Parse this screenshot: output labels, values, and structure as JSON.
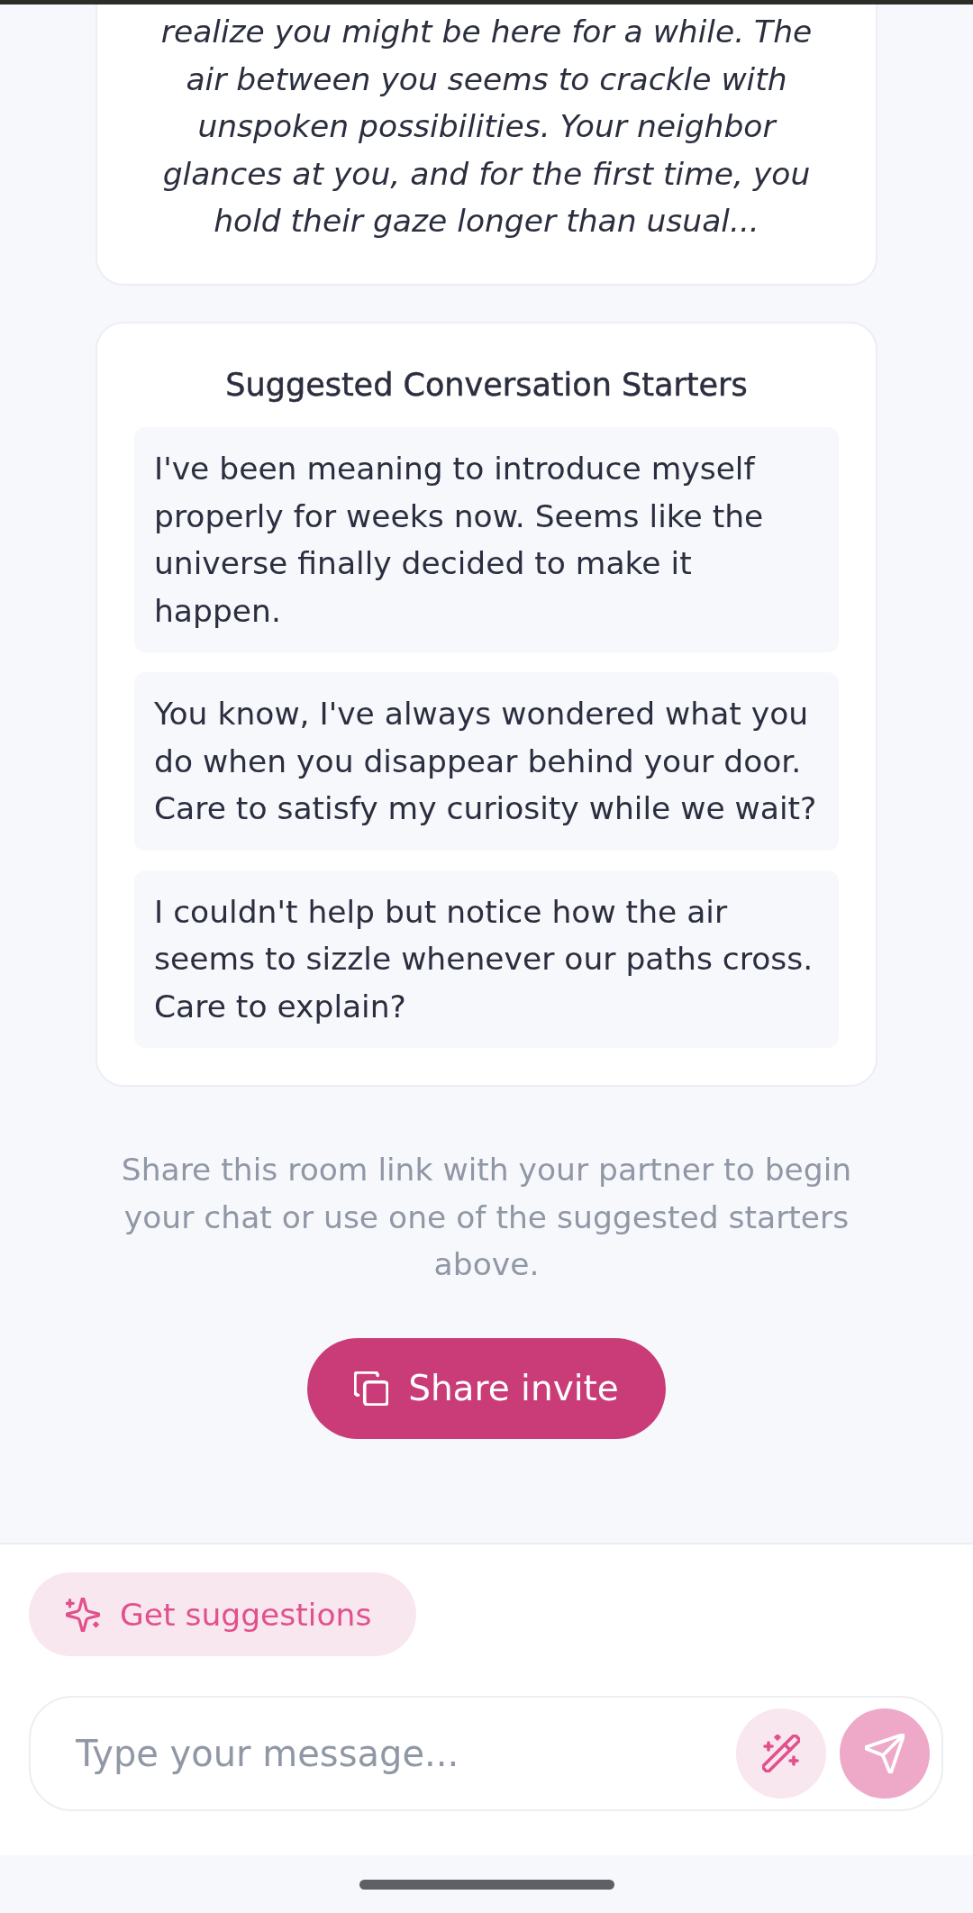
{
  "story": {
    "text": "realize you might be here for a while. The air between you seems to crackle with unspoken possibilities. Your neighbor glances at you, and for the first time, you hold their gaze longer than usual..."
  },
  "starters": {
    "title": "Suggested Conversation Starters",
    "items": [
      "I've been meaning to introduce myself properly for weeks now. Seems like the universe finally decided to make it happen.",
      "You know, I've always wondered what you do when you disappear behind your door. Care to satisfy my curiosity while we wait?",
      "I couldn't help but notice how the air seems to sizzle whenever our paths cross. Care to explain?"
    ]
  },
  "share_hint": "Share this room link with your partner to begin your chat or use one of the suggested starters above.",
  "share_button": {
    "label": "Share invite"
  },
  "composer": {
    "suggestions_button": {
      "label": "Get suggestions"
    },
    "message_field": {
      "placeholder": "Type your message..."
    },
    "send_button": {
      "disabled": true
    }
  }
}
